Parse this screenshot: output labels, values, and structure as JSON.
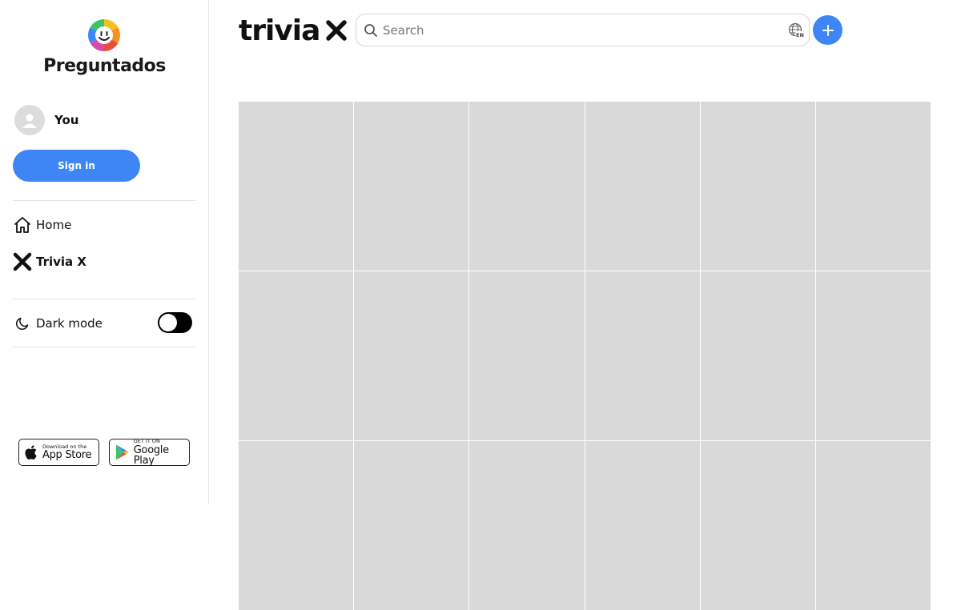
{
  "sidebar": {
    "brand": {
      "name": "Preguntados",
      "logo_icon": "preguntados-face-icon"
    },
    "user": {
      "name": "You",
      "avatar_icon": "user-avatar-icon"
    },
    "signin_label": "Sign in",
    "nav": [
      {
        "label": "Home",
        "icon": "home-icon"
      },
      {
        "label": "Trivia X",
        "icon": "trivia-x-icon"
      }
    ],
    "dark_mode": {
      "label": "Dark mode",
      "icon": "moon-icon",
      "enabled": false
    },
    "stores": {
      "apple": {
        "small": "Download on the",
        "big": "App Store",
        "icon": "apple-icon"
      },
      "google": {
        "small": "GET IT ON",
        "big": "Google Play",
        "icon": "google-play-icon"
      }
    }
  },
  "header": {
    "logo_text": "trivia",
    "search": {
      "placeholder": "Search",
      "value": ""
    },
    "language": "EN",
    "add_icon": "plus-icon"
  },
  "colors": {
    "accent": "#3e86f5",
    "tile": "#d9d9d9",
    "toggle": "#000000"
  },
  "grid": {
    "tile_count": 18
  }
}
